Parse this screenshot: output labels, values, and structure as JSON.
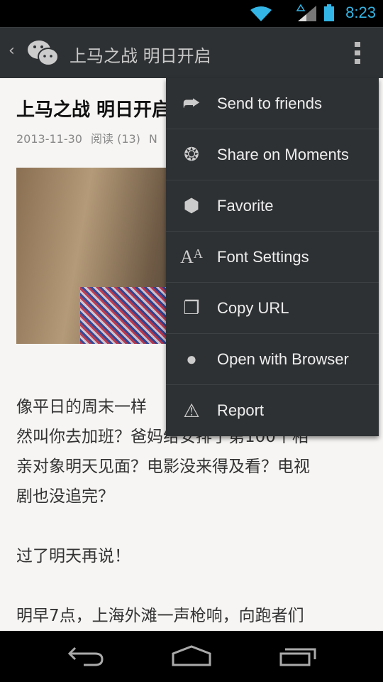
{
  "status_bar": {
    "time": "8:23",
    "icons": [
      "wifi-icon",
      "signal-icon",
      "battery-icon"
    ],
    "accent": "#33b5e5"
  },
  "app_bar": {
    "title": "上马之战 明日开启",
    "icons": [
      "back-icon",
      "wechat-logo",
      "overflow-menu-icon"
    ]
  },
  "article": {
    "title": "上马之战 明日开启",
    "date": "2013-11-30",
    "reads": "阅读 (13)",
    "meta_extra": "N",
    "lines": [
      "像平日的周末一样",
      "然叫你去加班？爸妈给安排了第100个相",
      "亲对象明天见面？电影没来得及看？电视",
      "剧也没追完？",
      "过了明天再说！",
      "明早7点，上海外滩一声枪响，向跑者们"
    ]
  },
  "menu": {
    "items": [
      {
        "label": "Send to friends",
        "icon": "share-icon"
      },
      {
        "label": "Share on Moments",
        "icon": "moments-aperture-icon"
      },
      {
        "label": "Favorite",
        "icon": "cube-icon"
      },
      {
        "label": "Font Settings",
        "icon": "font-icon"
      },
      {
        "label": "Copy URL",
        "icon": "copy-icon"
      },
      {
        "label": "Open with Browser",
        "icon": "globe-icon"
      },
      {
        "label": "Report",
        "icon": "warning-icon"
      }
    ]
  },
  "nav_bar": {
    "icons": [
      "back-nav-icon",
      "home-icon",
      "recents-icon"
    ]
  }
}
